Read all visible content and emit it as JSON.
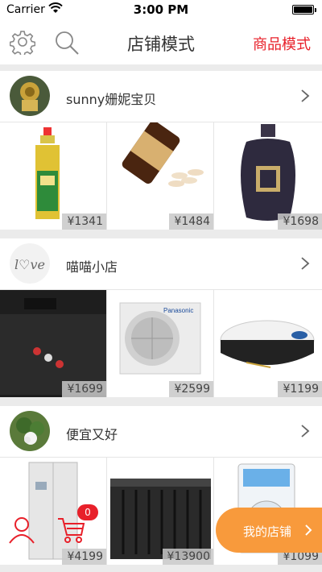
{
  "status": {
    "carrier": "Carrier",
    "time": "3:00 PM"
  },
  "nav": {
    "title": "店铺模式",
    "mode_link": "商品模式"
  },
  "shops": [
    {
      "name": "sunny姗妮宝贝",
      "prices": [
        "¥1341",
        "¥1484",
        "¥1698"
      ]
    },
    {
      "name": "喵喵小店",
      "prices": [
        "¥1699",
        "¥2599",
        "¥1199"
      ]
    },
    {
      "name": "便宜又好",
      "prices": [
        "¥4199",
        "¥13900",
        "¥1099"
      ]
    }
  ],
  "cart": {
    "count": "0"
  },
  "my_shop": {
    "label": "我的店铺"
  }
}
